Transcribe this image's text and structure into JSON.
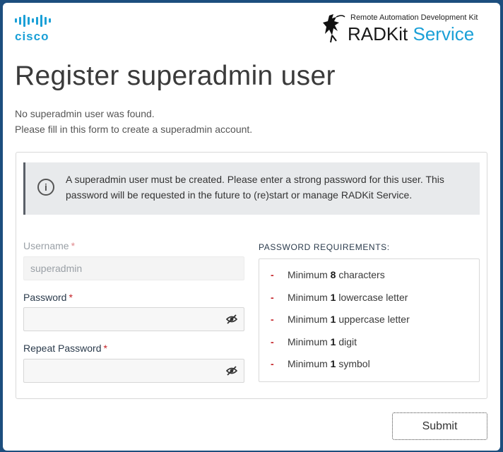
{
  "header": {
    "cisco_logo_text": "cisco",
    "radkit_tagline": "Remote Automation Development Kit",
    "radkit_name": "RADKit",
    "radkit_service": "Service"
  },
  "page": {
    "title": "Register superadmin user",
    "intro_line1": "No superadmin user was found.",
    "intro_line2": "Please fill in this form to create a superadmin account."
  },
  "alert": {
    "icon": "info-icon",
    "text": "A superadmin user must be created. Please enter a strong password for this user. This password will be requested in the future to (re)start or manage RADKit Service."
  },
  "form": {
    "username_label": "Username",
    "username_value": "superadmin",
    "password_label": "Password",
    "password_value": "",
    "repeat_label": "Repeat Password",
    "repeat_value": "",
    "required_marker": "*"
  },
  "requirements": {
    "title": "PASSWORD REQUIREMENTS:",
    "dash": "-",
    "items": [
      {
        "prefix": "Minimum ",
        "count": "8",
        "suffix": " characters"
      },
      {
        "prefix": "Minimum ",
        "count": "1",
        "suffix": " lowercase letter"
      },
      {
        "prefix": "Minimum ",
        "count": "1",
        "suffix": " uppercase letter"
      },
      {
        "prefix": "Minimum ",
        "count": "1",
        "suffix": " digit"
      },
      {
        "prefix": "Minimum ",
        "count": "1",
        "suffix": " symbol"
      }
    ]
  },
  "actions": {
    "submit_label": "Submit"
  },
  "colors": {
    "brand_blue": "#1ba0d7",
    "required_red": "#c42126",
    "background": "#1d4e7e"
  }
}
